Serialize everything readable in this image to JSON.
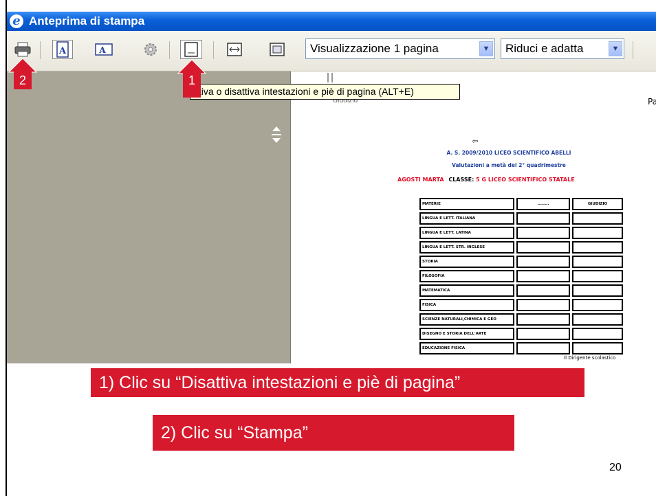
{
  "window": {
    "title": "Anteprima di stampa"
  },
  "toolbar": {
    "print_icon": "printer-icon",
    "view_select": "Visualizzazione 1 pagina",
    "scale_select": "Riduci e adatta",
    "dropdown_icon": "chevron-down-icon"
  },
  "tooltip": {
    "text": "ttiva o disattiva intestazioni e piè di pagina (ALT+E)"
  },
  "callouts": {
    "badge_1": "1",
    "badge_2": "2"
  },
  "banners": {
    "step1": "1) Clic su “Disattiva intestazioni e piè di pagina”",
    "step2": "2) Clic su “Stampa”"
  },
  "page_number": "20",
  "preview": {
    "header_left": "Giudizio",
    "header_right": "Pa",
    "back_icon": "⇦",
    "school_line": "A. S. 2009/2010 LICEO SCIENTIFICO ABELLI",
    "subtitle": "Valutazioni a metà del 2° quadrimestre",
    "student_name": "AGOSTI MARTA",
    "class_label": "CLASSE:",
    "class_value": "5 G LICEO SCIENTIFICO STATALE",
    "table": {
      "headers": [
        "MATERIE",
        "........",
        "GIUDIZIO"
      ],
      "rows": [
        "LINGUA E LETT. ITALIANA",
        "LINGUA E LETT. LATINA",
        "LINGUA E LETT. STR. INGLESE",
        "STORIA",
        "FILOSOFIA",
        "MATEMATICA",
        "FISICA",
        "SCIENZE NATURALI,CHIMICA E GEO",
        "DISEGNO E STORIA DELL'ARTE",
        "EDUCAZIONE FISICA"
      ]
    },
    "signature": "Il Dirigente scolastico"
  },
  "colors": {
    "accent_red": "#d7192d",
    "titlebar_blue": "#0a5fd6",
    "workspace_gray": "#a9a596"
  }
}
